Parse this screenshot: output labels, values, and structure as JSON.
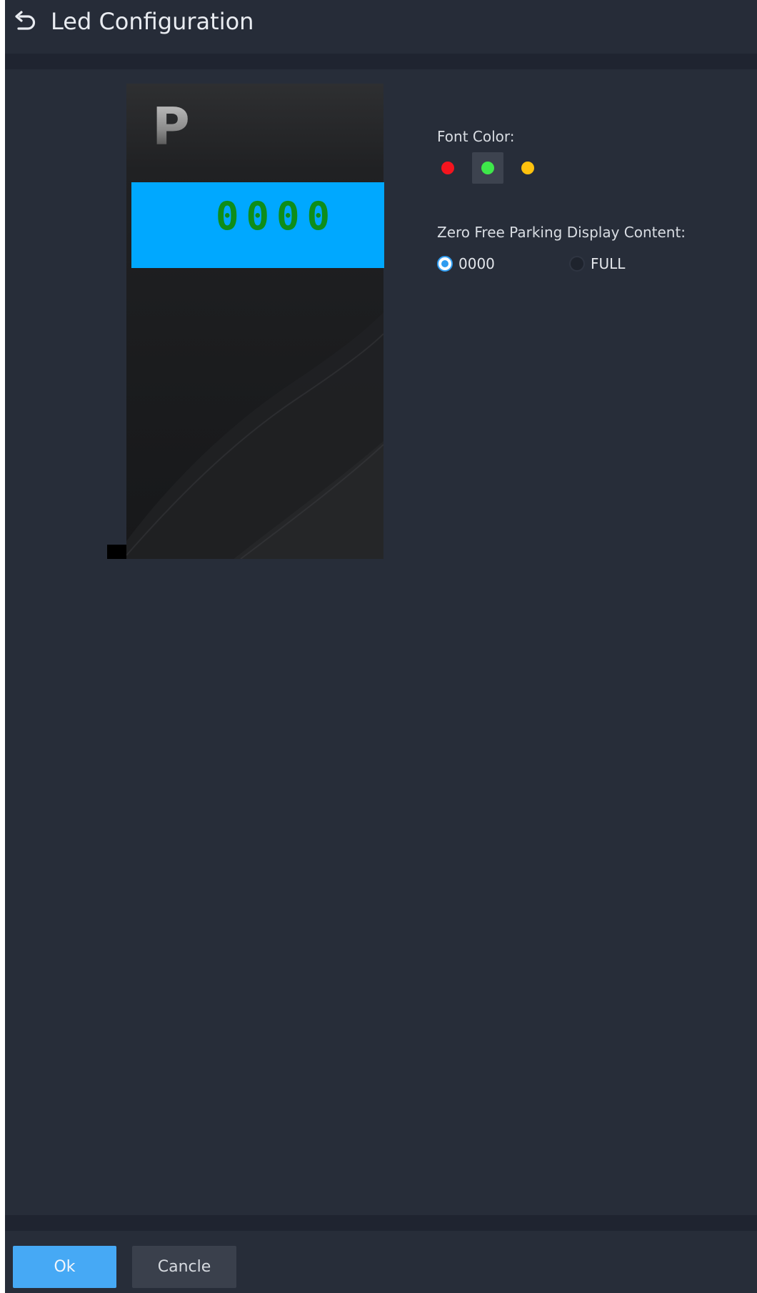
{
  "header": {
    "title": "Led Configuration",
    "back_icon": "undo-arrow-icon"
  },
  "preview": {
    "parking_symbol": "P",
    "led_text": "0000",
    "led_background": "#00a8ff",
    "led_text_color": "#0e8d1a"
  },
  "font_color": {
    "label": "Font Color:",
    "options": [
      {
        "name": "red",
        "color": "#f4141e"
      },
      {
        "name": "green",
        "color": "#3ee84a"
      },
      {
        "name": "yellow",
        "color": "#ffc20e"
      }
    ],
    "selected": "green"
  },
  "zero_free_display": {
    "label": "Zero Free Parking Display Content:",
    "options": [
      {
        "label": "0000",
        "selected": true
      },
      {
        "label": "FULL",
        "selected": false
      }
    ]
  },
  "footer": {
    "ok_label": "Ok",
    "cancel_label": "Cancle"
  }
}
